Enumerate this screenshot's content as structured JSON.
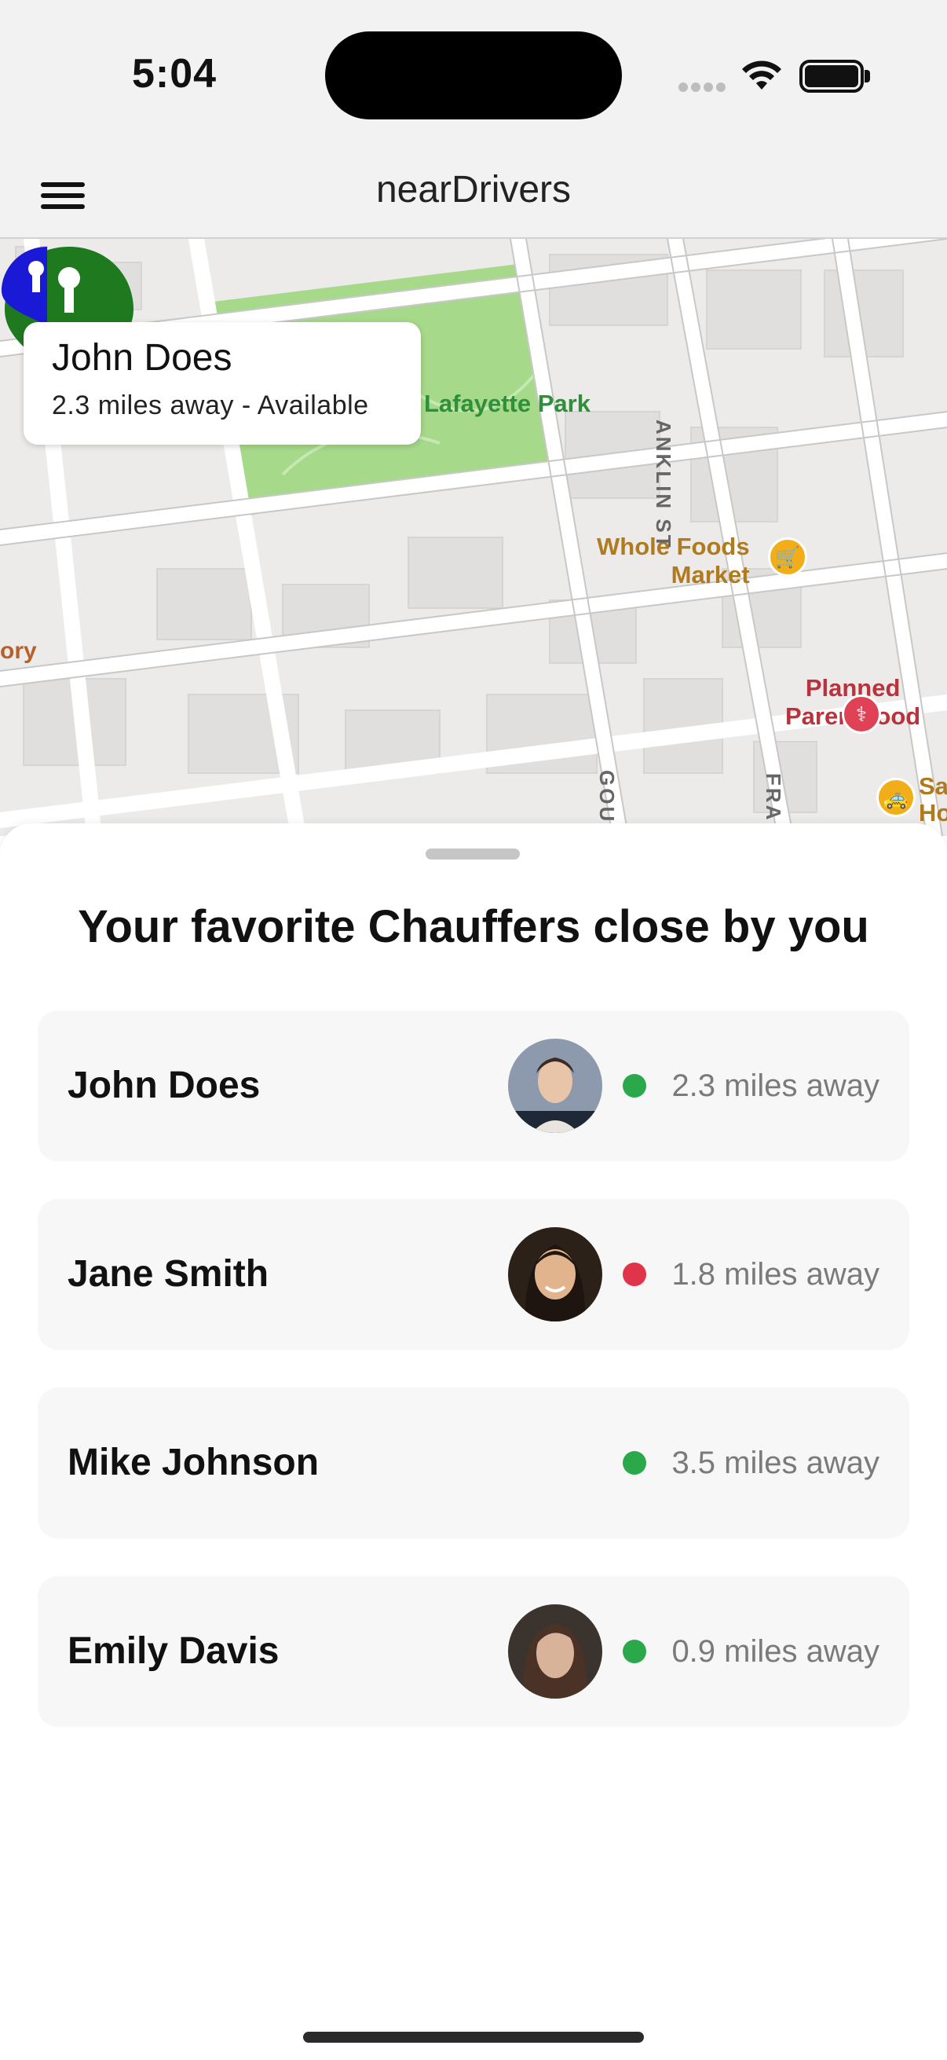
{
  "status_bar": {
    "time": "5:04"
  },
  "nav": {
    "title": "nearDrivers",
    "menu_icon": "hamburger-menu-icon"
  },
  "map": {
    "park_label": "Lafayette Park",
    "poi_whole_foods": [
      "Whole Foods",
      "Market"
    ],
    "poi_planned_parenthood": [
      "Planned",
      "Parenthood"
    ],
    "poi_partial": [
      "Sa",
      "Ho"
    ],
    "streets": {
      "franklin": "ANKLIN ST",
      "gough": "GOU",
      "fra": "FRA",
      "left_partial": "ory"
    },
    "pins": [
      {
        "color": "#1f7a1f",
        "icon": "map-pin-icon"
      },
      {
        "color": "#1a1ad6",
        "icon": "map-pin-icon"
      }
    ],
    "callout": {
      "name": "John Does",
      "subtitle": "2.3 miles away - Available"
    }
  },
  "sheet": {
    "title": "Your favorite Chauffers close by you",
    "drivers": [
      {
        "name": "John Does",
        "distance": "2.3 miles away",
        "status_color": "#2aa84a",
        "has_avatar": true
      },
      {
        "name": "Jane Smith",
        "distance": "1.8 miles away",
        "status_color": "#e0344a",
        "has_avatar": true
      },
      {
        "name": "Mike Johnson",
        "distance": "3.5 miles away",
        "status_color": "#2aa84a",
        "has_avatar": false
      },
      {
        "name": "Emily Davis",
        "distance": "0.9 miles away",
        "status_color": "#2aa84a",
        "has_avatar": true
      }
    ]
  },
  "colors": {
    "accent_green": "#1f7a1f",
    "available": "#2aa84a",
    "unavailable": "#e0344a",
    "park": "#a7d98a"
  }
}
